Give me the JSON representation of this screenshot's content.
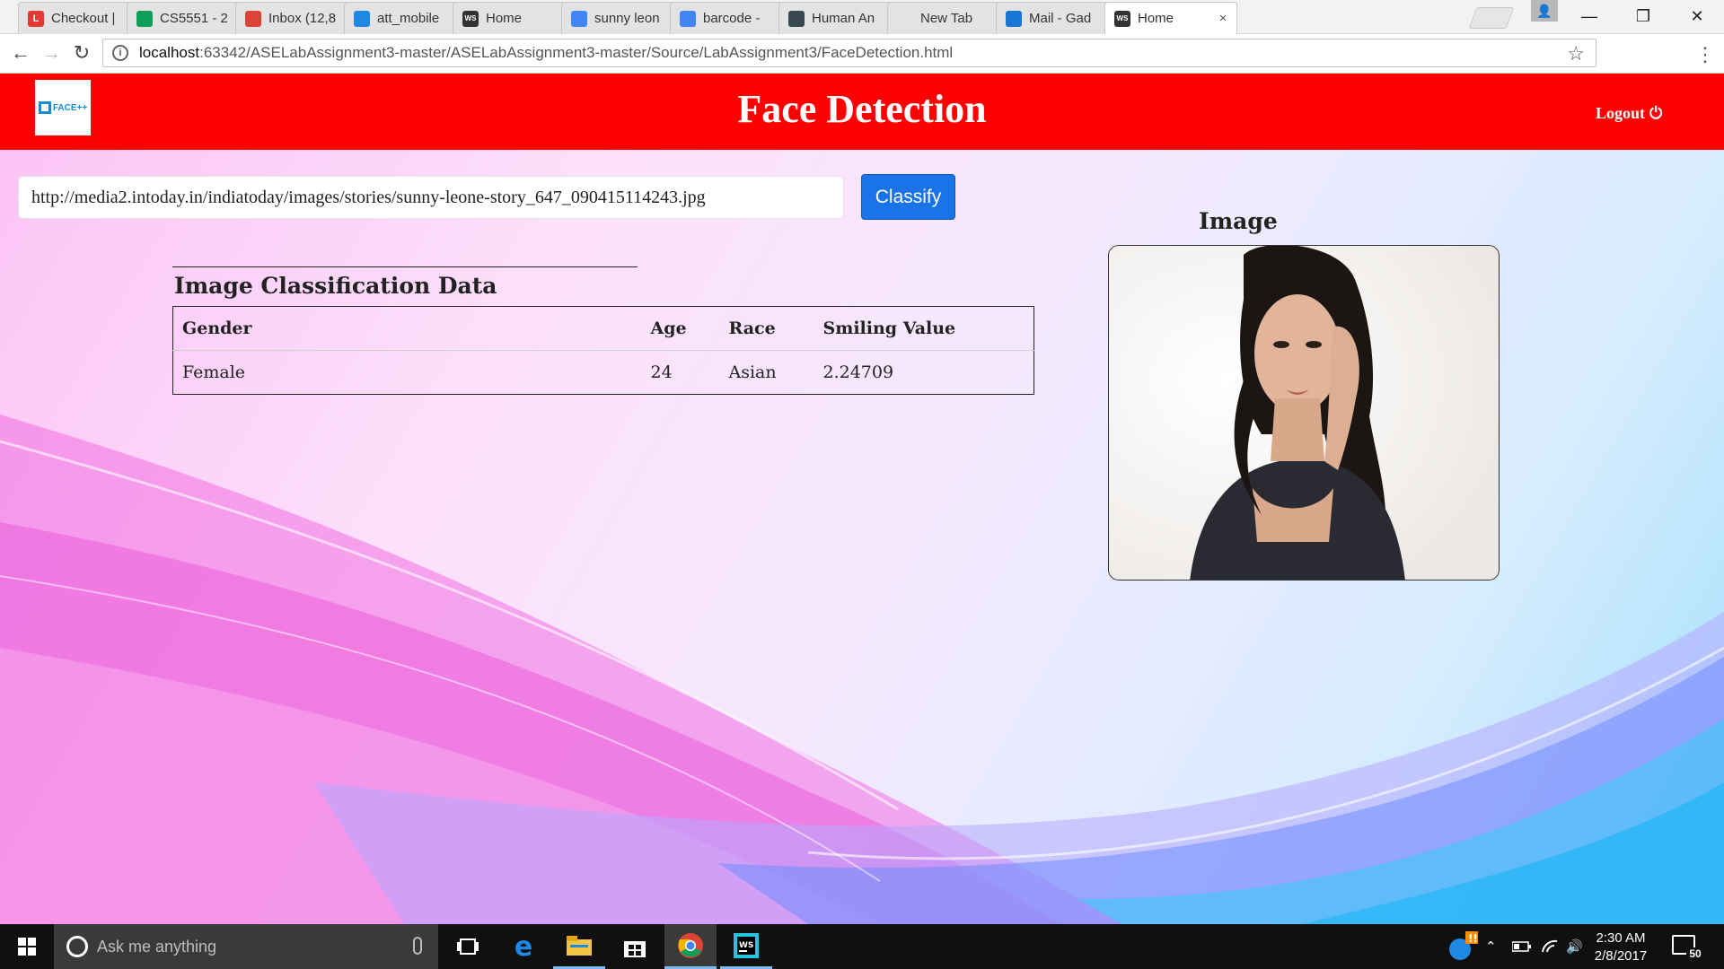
{
  "browser": {
    "tabs": [
      {
        "label": "Checkout |",
        "favicon": "L",
        "favicon_color": "#e53935"
      },
      {
        "label": "CS5551 - 2",
        "favicon": "sheets-icon",
        "favicon_color": "#0f9d58"
      },
      {
        "label": "Inbox (12,8",
        "favicon": "gmail-icon",
        "favicon_color": "#db4437"
      },
      {
        "label": "att_mobile",
        "favicon": "att-icon",
        "favicon_color": "#1e88e5"
      },
      {
        "label": "Home",
        "favicon": "WS",
        "favicon_color": "#333333"
      },
      {
        "label": "sunny leon",
        "favicon": "google-icon",
        "favicon_color": "#4285f4"
      },
      {
        "label": "barcode - ",
        "favicon": "google-icon",
        "favicon_color": "#4285f4"
      },
      {
        "label": "Human An",
        "favicon": "doc-icon",
        "favicon_color": "#37474f"
      },
      {
        "label": "New Tab",
        "favicon": "",
        "favicon_color": "#ffffff"
      },
      {
        "label": "Mail - Gad",
        "favicon": "mail-icon",
        "favicon_color": "#1976d2"
      },
      {
        "label": "Home",
        "favicon": "WS",
        "favicon_color": "#333333"
      }
    ],
    "active_tab_index": 10,
    "url_host": "localhost",
    "url_rest": ":63342/ASELabAssignment3-master/ASELabAssignment3-master/Source/LabAssignment3/FaceDetection.html"
  },
  "app": {
    "logo_text": "FACE++",
    "title": "Face Detection",
    "logout_label": "Logout",
    "header_color": "#ff0000"
  },
  "form": {
    "image_url_value": "http://media2.intoday.in/indiatoday/images/stories/sunny-leone-story_647_090415114243.jpg",
    "classify_label": "Classify",
    "button_color": "#1a73e8"
  },
  "results": {
    "title": "Image Classification Data",
    "columns": [
      "Gender",
      "Age",
      "Race",
      "Smiling Value"
    ],
    "rows": [
      [
        "Female",
        "24",
        "Asian",
        "2.24709"
      ]
    ]
  },
  "image_panel": {
    "title": "Image"
  },
  "taskbar": {
    "search_placeholder": "Ask me anything",
    "clock_time": "2:30 AM",
    "clock_date": "2/8/2017",
    "notification_count": "50"
  }
}
